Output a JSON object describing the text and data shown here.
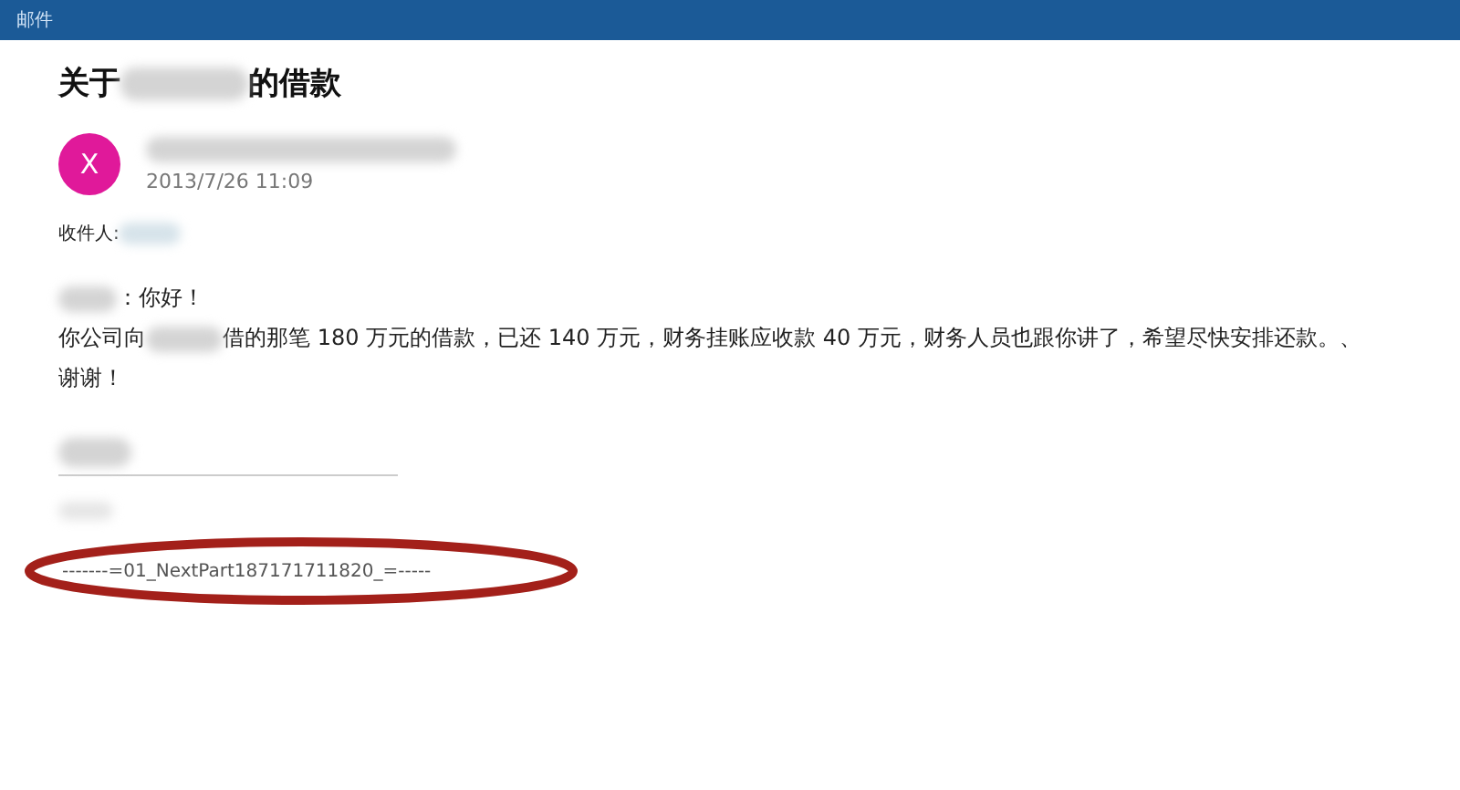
{
  "app_bar": {
    "title": "邮件"
  },
  "message": {
    "subject_start": "关于",
    "subject_end": "的借款",
    "avatar": "X",
    "date": "2013/7/26 11:09",
    "recipient_label": "收件人:",
    "greeting": "：你好！",
    "body_start": "你公司向",
    "body_rest": "借的那笔 180 万元的借款，已还 140 万元，财务挂账应收款 40 万元，财务人员也跟你讲了，希望尽快安排还款。、",
    "closing": "谢谢！",
    "boundary": "-------=01_NextPart187171711820_=-----"
  }
}
